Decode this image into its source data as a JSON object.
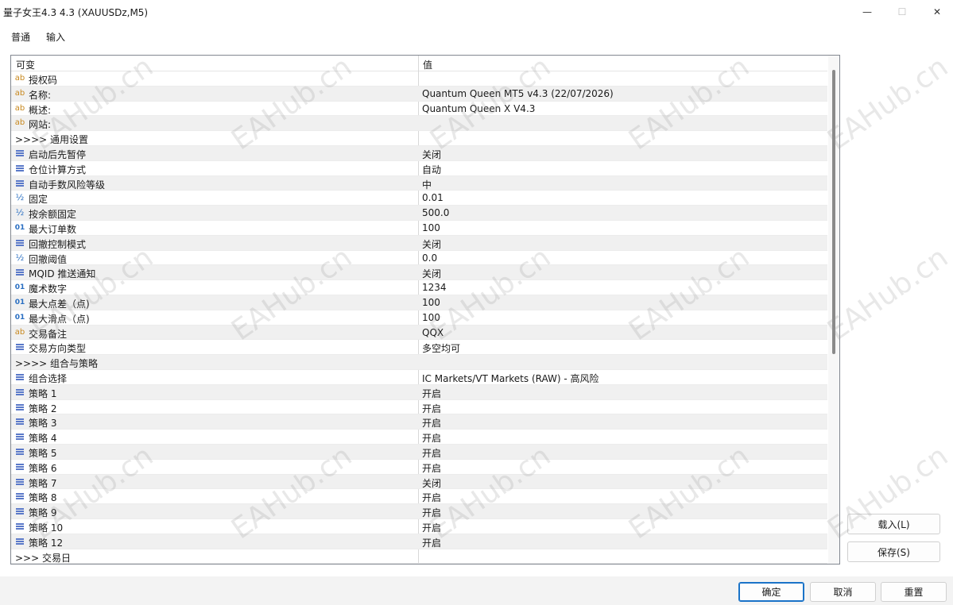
{
  "window": {
    "title": "量子女王4.3 4.3 (XAUUSDz,M5)",
    "minimize_glyph": "—",
    "maximize_glyph": "☐",
    "close_glyph": "✕"
  },
  "tabs": [
    {
      "label": "普通",
      "active": false
    },
    {
      "label": "输入",
      "active": true
    }
  ],
  "grid": {
    "col_variable": "可变",
    "col_value": "值",
    "rows": [
      {
        "icon": "ab",
        "name": "授权码",
        "value": ""
      },
      {
        "icon": "ab",
        "name": "名称:",
        "value": "Quantum Queen MT5 v4.3 (22/07/2026)"
      },
      {
        "icon": "ab",
        "name": "概述:",
        "value": "Quantum Queen X V4.3"
      },
      {
        "icon": "ab",
        "name": "网站:",
        "value": ""
      },
      {
        "icon": "",
        "name": ">>>> 通用设置",
        "value": ""
      },
      {
        "icon": "list",
        "name": "启动后先暂停",
        "value": "关闭"
      },
      {
        "icon": "list",
        "name": "仓位计算方式",
        "value": "自动"
      },
      {
        "icon": "list",
        "name": "自动手数风险等级",
        "value": "中"
      },
      {
        "icon": "half",
        "name": "固定",
        "value": "0.01"
      },
      {
        "icon": "half",
        "name": "按余额固定",
        "value": "500.0"
      },
      {
        "icon": "01",
        "name": "最大订单数",
        "value": "100"
      },
      {
        "icon": "list",
        "name": "回撤控制模式",
        "value": "关闭"
      },
      {
        "icon": "half",
        "name": "回撤阈值",
        "value": "0.0"
      },
      {
        "icon": "list",
        "name": "MQID 推送通知",
        "value": "关闭"
      },
      {
        "icon": "01",
        "name": "魔术数字",
        "value": "1234"
      },
      {
        "icon": "01",
        "name": "最大点差（点)",
        "value": "100"
      },
      {
        "icon": "01",
        "name": "最大滑点（点)",
        "value": "100"
      },
      {
        "icon": "ab",
        "name": "交易备注",
        "value": "QQX"
      },
      {
        "icon": "list",
        "name": "交易方向类型",
        "value": "多空均可"
      },
      {
        "icon": "",
        "name": ">>>> 组合与策略",
        "value": ""
      },
      {
        "icon": "list",
        "name": "组合选择",
        "value": "IC Markets/VT Markets (RAW) - 高风险"
      },
      {
        "icon": "list",
        "name": "策略 1",
        "value": "开启"
      },
      {
        "icon": "list",
        "name": "策略 2",
        "value": "开启"
      },
      {
        "icon": "list",
        "name": "策略 3",
        "value": "开启"
      },
      {
        "icon": "list",
        "name": "策略 4",
        "value": "开启"
      },
      {
        "icon": "list",
        "name": "策略 5",
        "value": "开启"
      },
      {
        "icon": "list",
        "name": "策略 6",
        "value": "开启"
      },
      {
        "icon": "list",
        "name": "策略 7",
        "value": "关闭"
      },
      {
        "icon": "list",
        "name": "策略 8",
        "value": "开启"
      },
      {
        "icon": "list",
        "name": "策略 9",
        "value": "开启"
      },
      {
        "icon": "list",
        "name": "策略 10",
        "value": "开启"
      },
      {
        "icon": "list",
        "name": "策略 12",
        "value": "开启"
      },
      {
        "icon": "",
        "name": ">>> 交易日",
        "value": ""
      }
    ]
  },
  "buttons": {
    "load": "载入(L)",
    "save": "保存(S)",
    "ok": "确定",
    "cancel": "取消",
    "reset": "重置"
  },
  "watermark": "EAHub.cn"
}
